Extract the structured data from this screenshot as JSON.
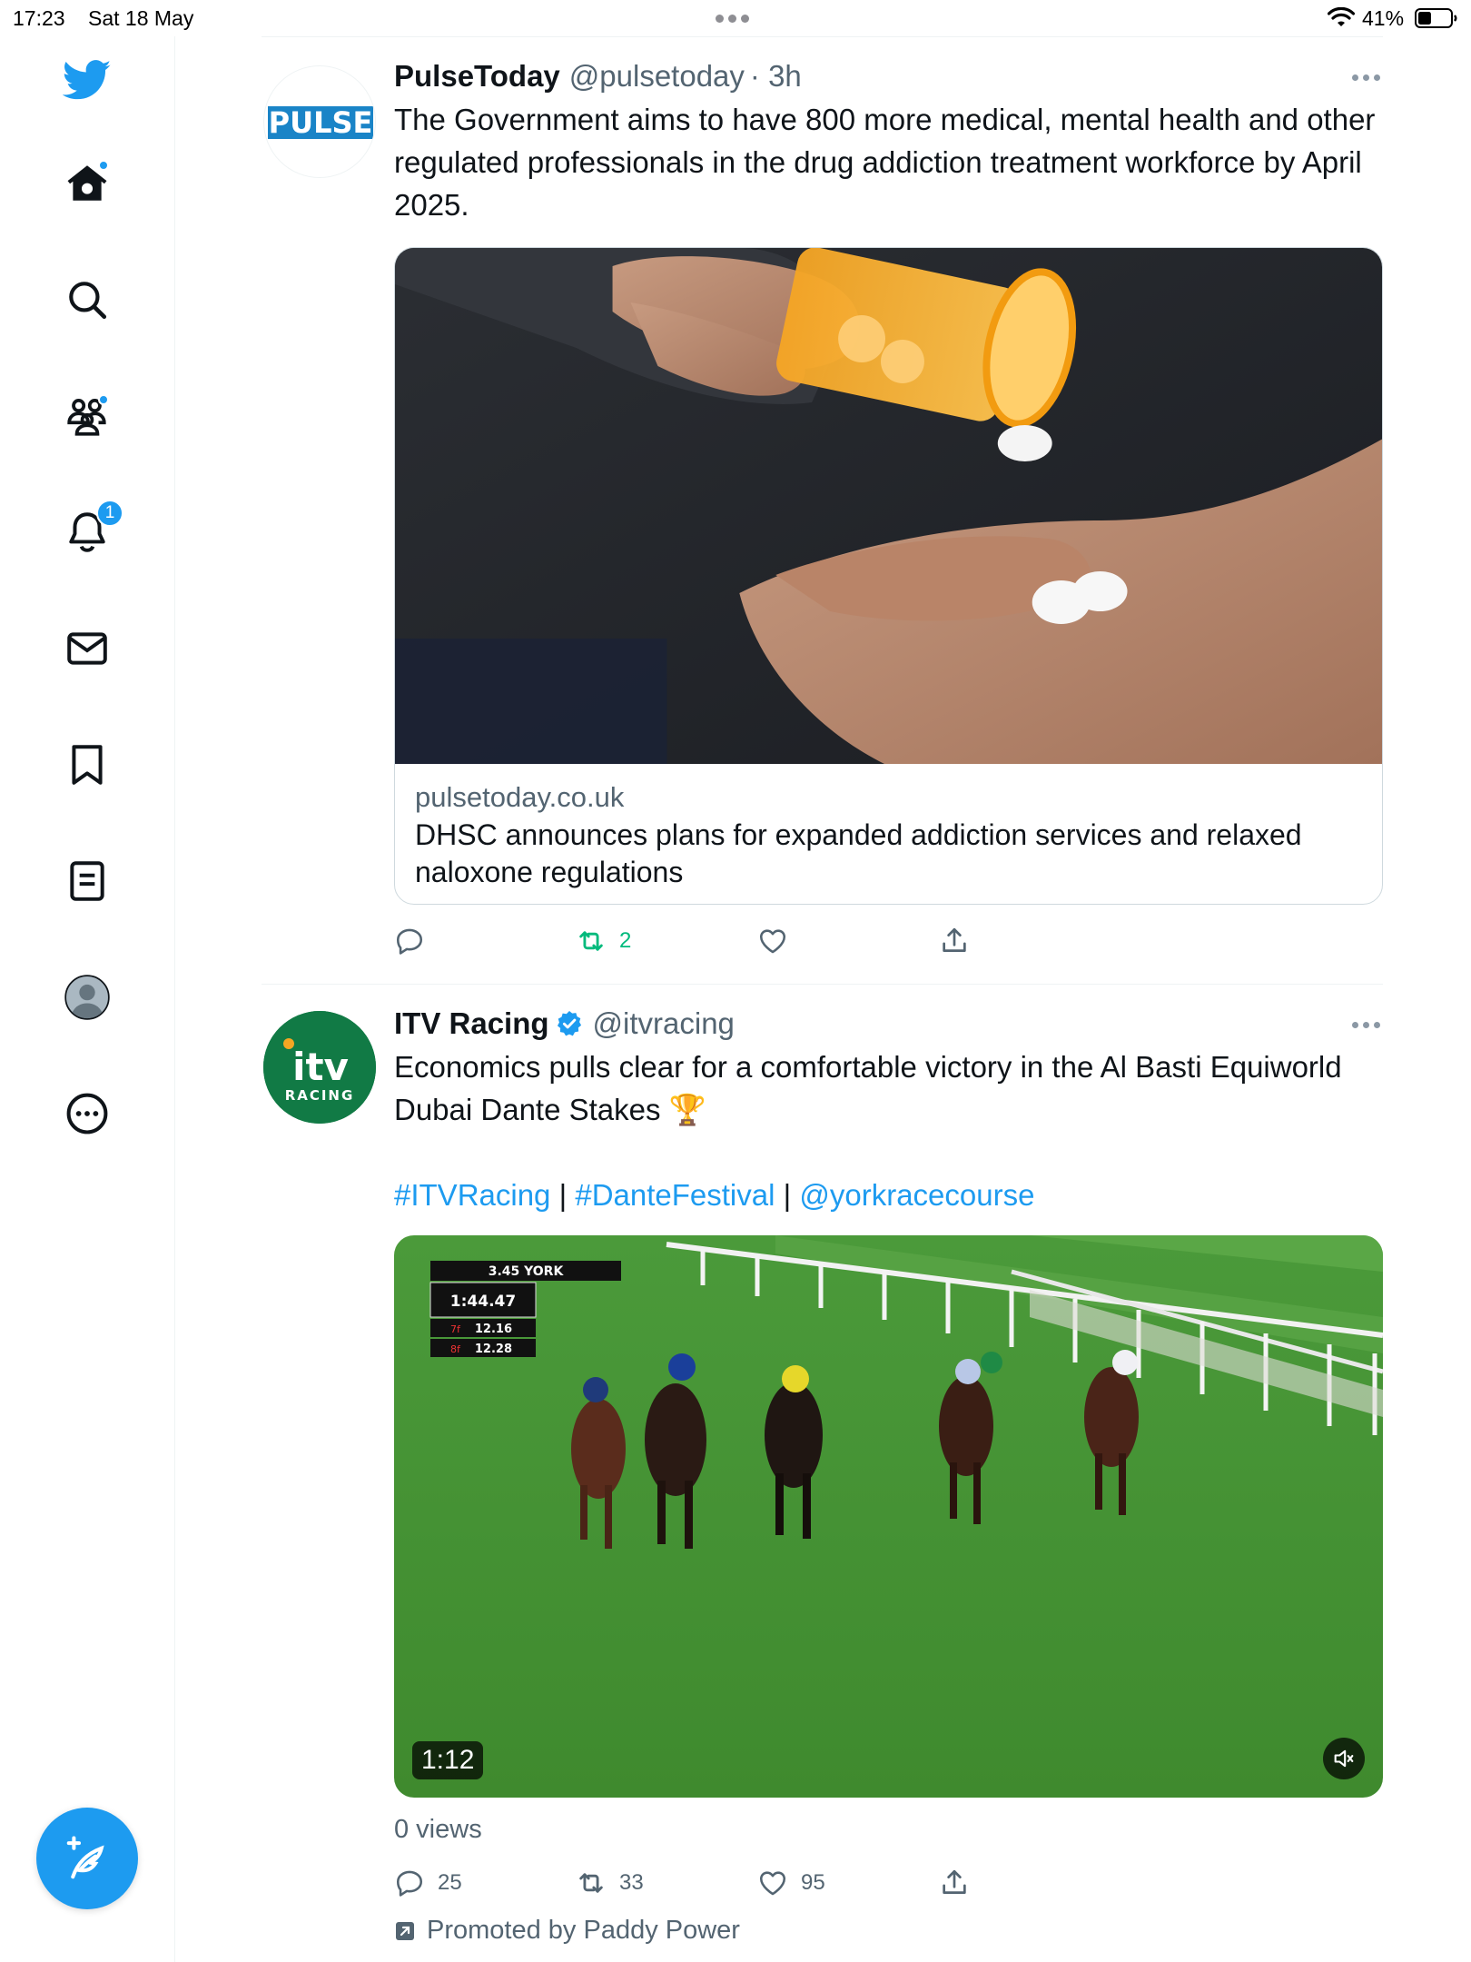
{
  "status_bar": {
    "time": "17:23",
    "date": "Sat 18 May",
    "battery_percent": "41%",
    "battery_level": 0.41
  },
  "sidebar": {
    "items": [
      {
        "icon": "twitter-logo-icon"
      },
      {
        "icon": "home-icon",
        "has_dot": true
      },
      {
        "icon": "search-icon"
      },
      {
        "icon": "communities-icon",
        "has_dot": true
      },
      {
        "icon": "bell-icon",
        "badge": "1"
      },
      {
        "icon": "mail-icon"
      },
      {
        "icon": "bookmark-icon"
      },
      {
        "icon": "lists-icon"
      },
      {
        "icon": "profile-avatar-icon"
      },
      {
        "icon": "more-circle-icon"
      }
    ],
    "compose_icon": "compose-feather-icon"
  },
  "colors": {
    "accent": "#1d9bf0",
    "retweet_active": "#00ba7c",
    "secondary_text": "#536471",
    "border": "#cfd9de"
  },
  "tweets": [
    {
      "author": "PulseToday",
      "handle": "@pulsetoday",
      "time": "· 3h",
      "avatar_text": "PULSE",
      "text": "The Government aims to have 800 more medical, mental health and other regulated professionals in the drug addiction treatment workforce by April 2025.",
      "card": {
        "domain": "pulsetoday.co.uk",
        "title": "DHSC announces plans for expanded addiction services and relaxed naloxone regulations"
      },
      "actions": {
        "replies": "",
        "retweets": "2",
        "likes": "",
        "share": ""
      }
    },
    {
      "author": "ITV Racing",
      "verified": true,
      "handle": "@itvracing",
      "avatar_text_top": "itv",
      "avatar_text_bottom": "RACING",
      "text": "Economics pulls clear for a comfortable victory in the Al Basti Equiworld Dubai Dante Stakes 🏆",
      "links": [
        "#ITVRacing",
        "#DanteFestival",
        "@yorkracecourse"
      ],
      "link_separator": "|",
      "video": {
        "duration": "1:12",
        "scoreboard": {
          "race": "3.45 YORK",
          "time": "1:44.47",
          "rows": [
            {
              "label": "7f",
              "value": "12.16"
            },
            {
              "label": "8f",
              "value": "12.28"
            }
          ]
        }
      },
      "views": "0 views",
      "actions": {
        "replies": "25",
        "retweets": "33",
        "likes": "95",
        "share": ""
      },
      "promoted": "Promoted by Paddy Power"
    }
  ]
}
